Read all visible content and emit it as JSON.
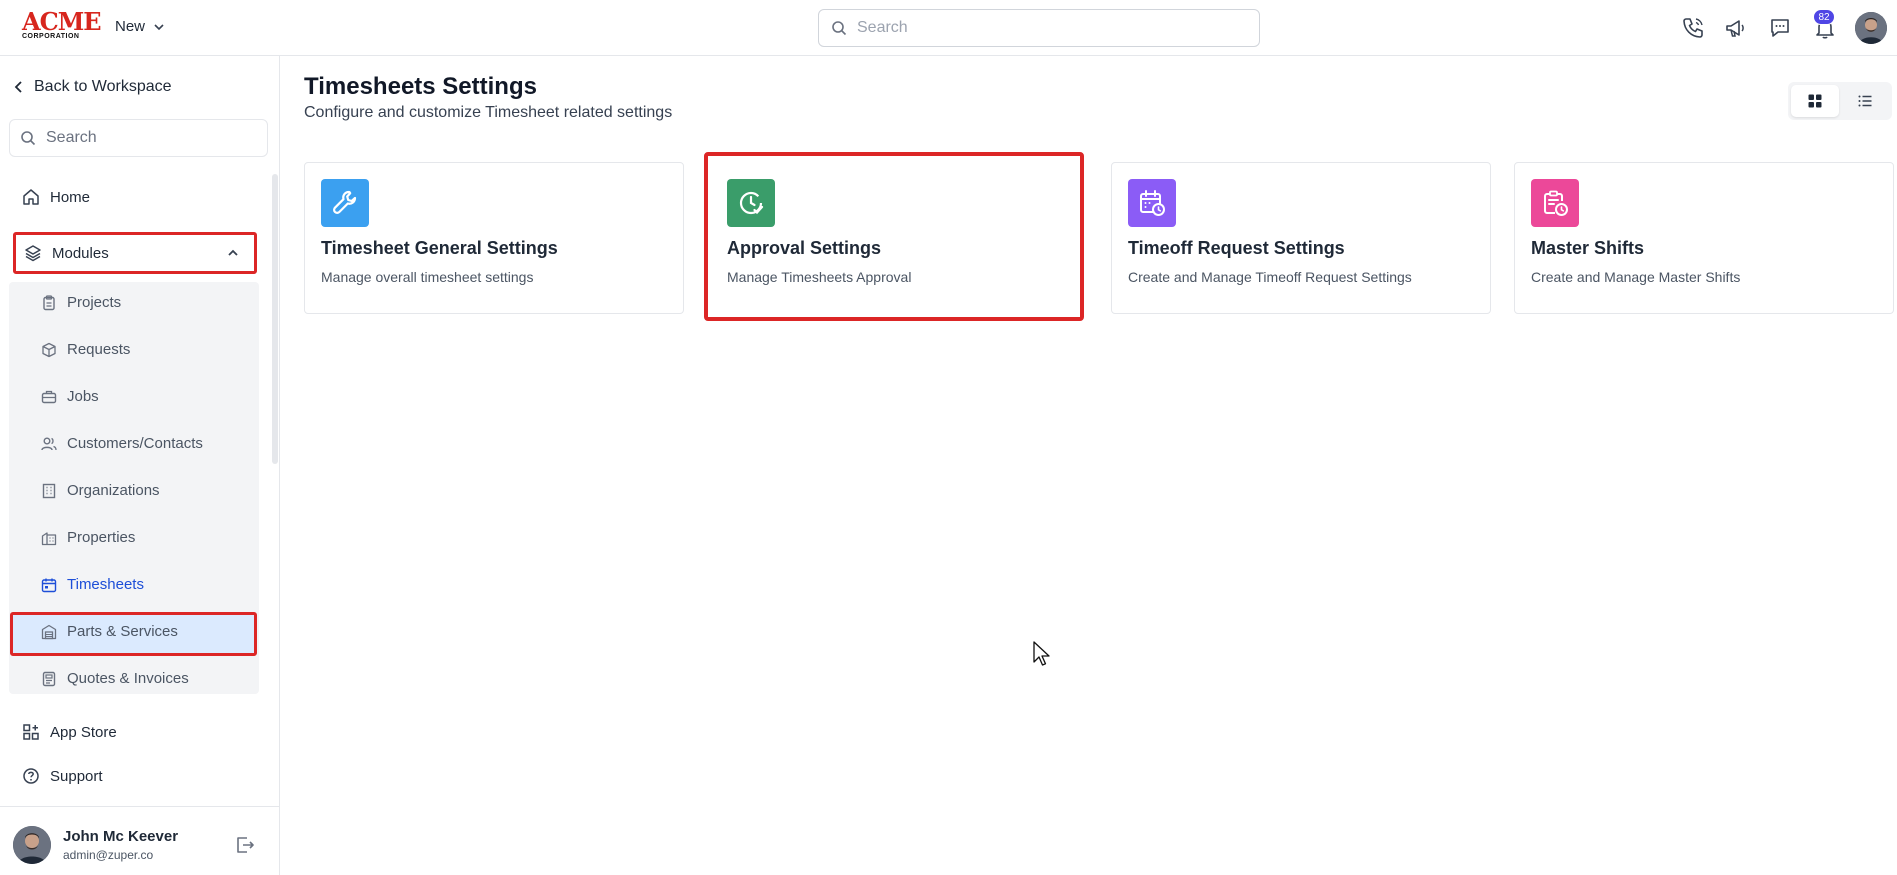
{
  "brand": {
    "logo_main": "ACME",
    "logo_sub": "CORPORATION"
  },
  "topbar": {
    "new_label": "New",
    "search_placeholder": "Search",
    "notification_count": "82",
    "icons": [
      "phone-icon",
      "megaphone-icon",
      "chat-icon",
      "bell-icon"
    ]
  },
  "sidebar": {
    "back_label": "Back to Workspace",
    "search_placeholder": "Search",
    "home_label": "Home",
    "modules_label": "Modules",
    "modules": [
      {
        "label": "Projects",
        "icon": "clipboard-icon"
      },
      {
        "label": "Requests",
        "icon": "box-icon"
      },
      {
        "label": "Jobs",
        "icon": "briefcase-icon"
      },
      {
        "label": "Customers/Contacts",
        "icon": "users-icon"
      },
      {
        "label": "Organizations",
        "icon": "building-icon"
      },
      {
        "label": "Properties",
        "icon": "property-icon"
      },
      {
        "label": "Timesheets",
        "icon": "calendar-icon",
        "active": true
      },
      {
        "label": "Parts & Services",
        "icon": "warehouse-icon"
      },
      {
        "label": "Quotes & Invoices",
        "icon": "invoice-icon"
      }
    ],
    "app_store_label": "App Store",
    "support_label": "Support",
    "user": {
      "name": "John Mc Keever",
      "email": "admin@zuper.co"
    }
  },
  "main": {
    "title": "Timesheets Settings",
    "subtitle": "Configure and customize Timesheet related settings",
    "cards": [
      {
        "title": "Timesheet General Settings",
        "description": "Manage overall timesheet settings",
        "icon": "wrench-icon",
        "color": "#3ba0f0"
      },
      {
        "title": "Approval Settings",
        "description": "Manage Timesheets Approval",
        "icon": "clock-check-icon",
        "color": "#3a9d6a"
      },
      {
        "title": "Timeoff Request Settings",
        "description": "Create and Manage Timeoff Request Settings",
        "icon": "calendar-clock-icon",
        "color": "#8b5cf6"
      },
      {
        "title": "Master Shifts",
        "description": "Create and Manage Master Shifts",
        "icon": "clipboard-clock-icon",
        "color": "#ec4899"
      }
    ]
  },
  "colors": {
    "highlight": "#dc2626",
    "active_bg": "#dbeafe",
    "active_text": "#1d4ed8",
    "badge": "#4f46e5"
  }
}
